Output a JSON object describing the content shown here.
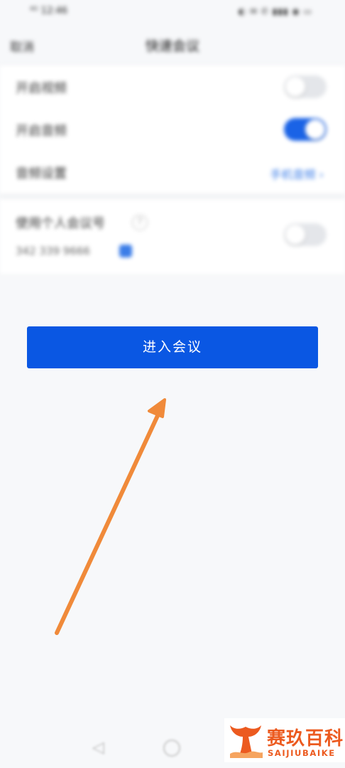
{
  "status_bar": {
    "time": "⁴ᴳ 12:46",
    "icons": "◐ ✉ ✆ ▮▮▮ ◉ ▭"
  },
  "nav": {
    "back_label": "取消",
    "title": "快速会议"
  },
  "settings": [
    {
      "label": "开启视频",
      "control": "toggle",
      "on": false
    },
    {
      "label": "开启音频",
      "control": "toggle",
      "on": true
    },
    {
      "label": "音频设置",
      "control": "value",
      "value": "手机音频 ›"
    }
  ],
  "personal": {
    "label": "使用个人会议号",
    "meeting_id": "342 339 9666",
    "help_icon": "?",
    "on": false
  },
  "enter_button": {
    "label": "进入会议"
  },
  "annotation": {
    "type": "arrow",
    "color": "#f08a3a"
  },
  "system_nav": {
    "back_icon": "◁"
  },
  "watermark": {
    "title": "赛玖百科",
    "subtitle": "SAIJIUBAIKE",
    "color": "#ec5a1f"
  }
}
